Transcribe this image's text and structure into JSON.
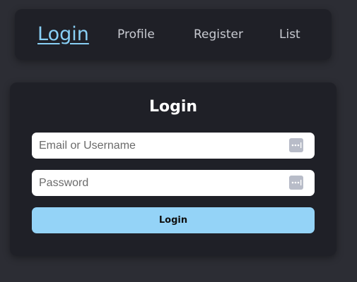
{
  "nav": {
    "items": [
      {
        "label": "Login",
        "active": true
      },
      {
        "label": "Profile",
        "active": false
      },
      {
        "label": "Register",
        "active": false
      },
      {
        "label": "List",
        "active": false
      }
    ]
  },
  "login_form": {
    "title": "Login",
    "username_placeholder": "Email or Username",
    "username_value": "",
    "password_placeholder": "Password",
    "password_value": "",
    "submit_label": "Login",
    "field_icon": "password-manager-dots-icon"
  },
  "colors": {
    "background": "#2c2d34",
    "panel": "#1f2027",
    "accent": "#88cff5",
    "button": "#94d3f7"
  }
}
